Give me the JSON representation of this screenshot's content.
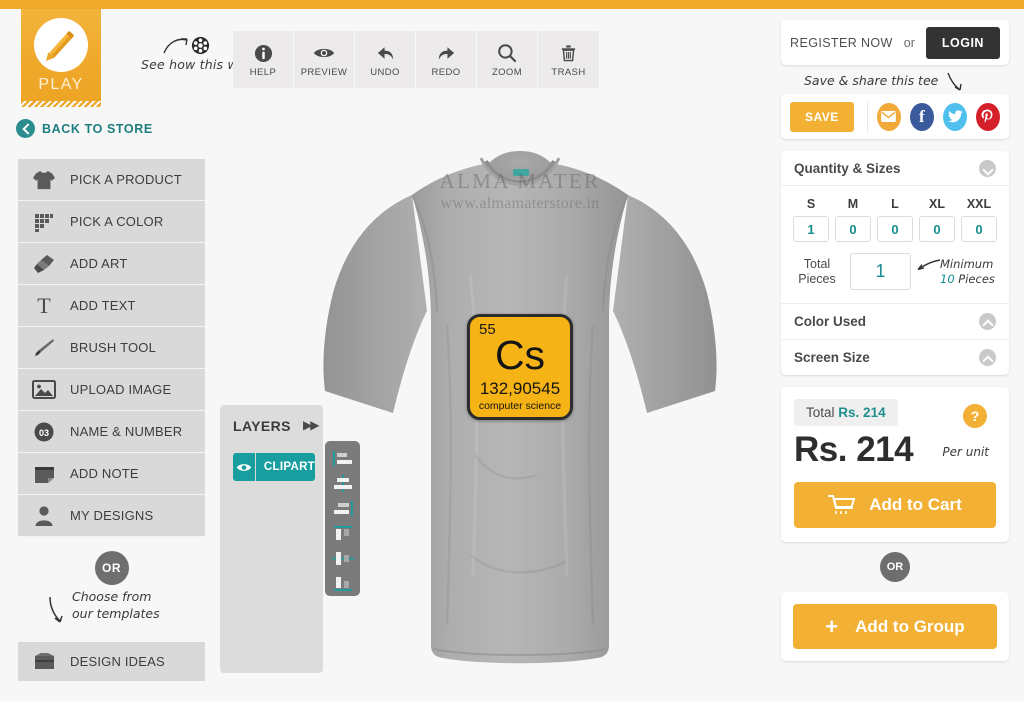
{
  "top": {
    "play_tab": {
      "label": "PLAY",
      "icon": "pencil-icon"
    },
    "see_how": "See how this works",
    "toolbar": [
      {
        "label": "HELP",
        "icon": "info-icon"
      },
      {
        "label": "PREVIEW",
        "icon": "eye-icon"
      },
      {
        "label": "UNDO",
        "icon": "undo-arrow-icon"
      },
      {
        "label": "REDO",
        "icon": "redo-arrow-icon"
      },
      {
        "label": "ZOOM",
        "icon": "magnifier-icon"
      },
      {
        "label": "TRASH",
        "icon": "trash-icon"
      }
    ]
  },
  "sidebar": {
    "back_label": "BACK TO STORE",
    "items": [
      {
        "label": "PICK A PRODUCT",
        "icon": "tshirt-icon"
      },
      {
        "label": "PICK A COLOR",
        "icon": "color-swatches-icon"
      },
      {
        "label": "ADD ART",
        "icon": "paint-brush-icon"
      },
      {
        "label": "ADD TEXT",
        "icon": "text-t-icon"
      },
      {
        "label": "BRUSH TOOL",
        "icon": "brush-icon"
      },
      {
        "label": "UPLOAD IMAGE",
        "icon": "image-icon"
      },
      {
        "label": "NAME & NUMBER",
        "icon": "number-03-icon"
      },
      {
        "label": "ADD NOTE",
        "icon": "note-icon"
      },
      {
        "label": "MY DESIGNS",
        "icon": "person-icon"
      }
    ],
    "or_badge": "OR",
    "templates_note_line1": "Choose from",
    "templates_note_line2": "our templates",
    "design_ideas": {
      "label": "DESIGN IDEAS",
      "icon": "folder-icon"
    }
  },
  "canvas": {
    "watermark_line1": "ALMA MATER",
    "watermark_line2": "www.almamaterstore.in",
    "tile": {
      "number": "55",
      "symbol": "Cs",
      "mass": "132,90545",
      "name": "computer science",
      "fill_color": "#f5b316",
      "border_color": "#2c2c2c"
    },
    "layers": {
      "title": "LAYERS",
      "expand_icon": "double-chevron-right-icon",
      "rows": [
        {
          "name": "CLIPART",
          "visible_icon": "eye-icon",
          "color": "#189e9e"
        }
      ],
      "align_buttons": [
        "align-left-icon",
        "align-center-horizontal-icon",
        "align-right-icon",
        "align-top-icon",
        "align-middle-vertical-icon",
        "align-bottom-icon"
      ]
    }
  },
  "right": {
    "register_label": "REGISTER NOW",
    "or_text": "or",
    "login_label": "LOGIN",
    "save_share_note": "Save & share this tee",
    "save_label": "SAVE",
    "social": [
      {
        "name": "email",
        "glyph": "✉",
        "color": "#f1a93a"
      },
      {
        "name": "facebook",
        "glyph": "f",
        "color": "#3b5a9b"
      },
      {
        "name": "twitter",
        "glyph": "ᴠ",
        "color": "#4fc0ee"
      },
      {
        "name": "pinterest",
        "glyph": "℘",
        "color": "#d5202a"
      }
    ],
    "quantity": {
      "title": "Quantity & Sizes",
      "sizes": [
        {
          "label": "S",
          "value": "1"
        },
        {
          "label": "M",
          "value": "0"
        },
        {
          "label": "L",
          "value": "0"
        },
        {
          "label": "XL",
          "value": "0"
        },
        {
          "label": "XXL",
          "value": "0"
        }
      ],
      "total_label_line1": "Total",
      "total_label_line2": "Pieces",
      "total_value": "1",
      "minimum_line1": "Minimum",
      "minimum_count": "10",
      "minimum_line2": "Pieces"
    },
    "color_used_title": "Color Used",
    "screen_size_title": "Screen Size",
    "price": {
      "total_prefix": "Total",
      "total_value": "Rs. 214",
      "help_glyph": "?",
      "big_price": "Rs. 214",
      "per_unit": "Per unit",
      "cart_label": "Add to Cart",
      "cart_icon": "shopping-cart-icon"
    },
    "or_badge": "OR",
    "group": {
      "plus": "+",
      "label": "Add to Group"
    }
  },
  "colors": {
    "accent_orange": "#f2b134",
    "teal": "#189e9e",
    "dark": "#333333"
  }
}
